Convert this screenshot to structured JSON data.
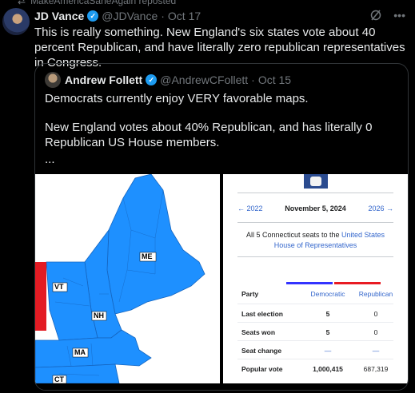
{
  "repost": {
    "label": "MakeAmericaSaneAgain reposted"
  },
  "tweet": {
    "name": "JD Vance",
    "handle": "@JDVance",
    "separator": "·",
    "date": "Oct 17",
    "text": "This is really something. New England's six states vote about 40 percent Republican, and have literally zero republican representatives in Congress."
  },
  "quote": {
    "name": "Andrew Follett",
    "handle": "@AndrewCFollett",
    "separator": "·",
    "date": "Oct 15",
    "paragraph1": "Democrats currently enjoy VERY favorable maps.",
    "paragraph2": "New England votes about 40% Republican, and has literally 0 Republican US House members.",
    "ellipsis": "..."
  },
  "map": {
    "labels": {
      "me": "ME",
      "vt": "VT",
      "nh": "NH",
      "ma": "MA",
      "ct": "CT"
    },
    "colors": {
      "dem": "#1e90ff",
      "rep": "#e31b23",
      "border": "#1565c0"
    }
  },
  "panel": {
    "prev": "← 2022",
    "current": "November 5, 2024",
    "next": "2026 →",
    "summary_prefix": "All 5 Connecticut seats to the ",
    "summary_link": "United States House of Representatives",
    "headers": {
      "party": "Party",
      "dem": "Democratic",
      "rep": "Republican"
    },
    "rows": [
      {
        "label": "Last election",
        "dem": "5",
        "rep": "0"
      },
      {
        "label": "Seats won",
        "dem": "5",
        "rep": "0"
      },
      {
        "label": "Seat change",
        "dem": "—",
        "rep": "—"
      },
      {
        "label": "Popular vote",
        "dem": "1,000,415",
        "rep": "687,319"
      }
    ]
  },
  "icons": {
    "grok": "grok-icon",
    "more": "more-icon",
    "verified": "verified-badge-icon",
    "repost": "repost-icon"
  }
}
